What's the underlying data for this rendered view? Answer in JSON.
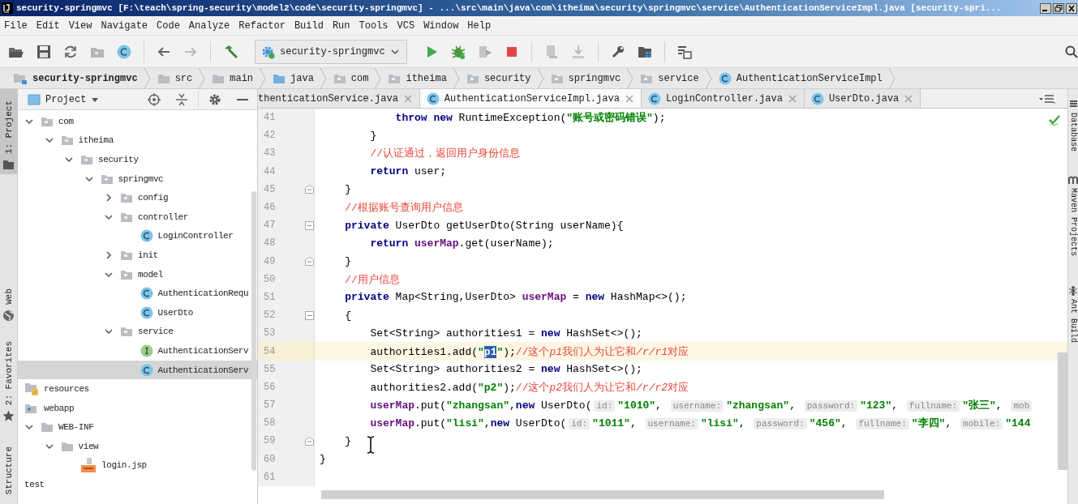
{
  "window": {
    "title": "security-springmvc [F:\\teach\\spring-security\\model2\\code\\security-springmvc] - ...\\src\\main\\java\\com\\itheima\\security\\springmvc\\service\\AuthenticationServiceImpl.java [security-spri..."
  },
  "menu": [
    "File",
    "Edit",
    "View",
    "Navigate",
    "Code",
    "Analyze",
    "Refactor",
    "Build",
    "Run",
    "Tools",
    "VCS",
    "Window",
    "Help"
  ],
  "toolbar": {
    "run_configuration": "security-springmvc"
  },
  "breadcrumbs": [
    {
      "label": "security-springmvc",
      "kind": "module"
    },
    {
      "label": "src",
      "kind": "folder"
    },
    {
      "label": "main",
      "kind": "folder"
    },
    {
      "label": "java",
      "kind": "source-folder"
    },
    {
      "label": "com",
      "kind": "package"
    },
    {
      "label": "itheima",
      "kind": "package"
    },
    {
      "label": "security",
      "kind": "package"
    },
    {
      "label": "springmvc",
      "kind": "package"
    },
    {
      "label": "service",
      "kind": "package"
    },
    {
      "label": "AuthenticationServiceImpl",
      "kind": "class"
    }
  ],
  "left_tool_tabs": [
    {
      "label": "1: Project",
      "kind": "project",
      "selected": true
    },
    {
      "label": "Web",
      "kind": "web",
      "selected": false
    },
    {
      "label": "2: Favorites",
      "kind": "favorites",
      "selected": false
    },
    {
      "label": "Structure",
      "selected": false
    }
  ],
  "project_panel": {
    "title": "Project",
    "tree": [
      {
        "label": "com",
        "kind": "package",
        "expanded": true,
        "selected": false,
        "children": [
          {
            "label": "itheima",
            "kind": "package",
            "expanded": true,
            "selected": false,
            "children": [
              {
                "label": "security",
                "kind": "package",
                "expanded": true,
                "selected": false,
                "children": [
                  {
                    "label": "springmvc",
                    "kind": "package",
                    "expanded": true,
                    "selected": false,
                    "children": [
                      {
                        "label": "config",
                        "kind": "package",
                        "expanded": false,
                        "selected": false
                      },
                      {
                        "label": "controller",
                        "kind": "package",
                        "expanded": true,
                        "selected": false,
                        "children": [
                          {
                            "label": "LoginController",
                            "kind": "class",
                            "selected": false
                          }
                        ]
                      },
                      {
                        "label": "init",
                        "kind": "package",
                        "expanded": false,
                        "selected": false
                      },
                      {
                        "label": "model",
                        "kind": "package",
                        "expanded": true,
                        "selected": false,
                        "children": [
                          {
                            "label": "AuthenticationRequ",
                            "kind": "class",
                            "selected": false
                          },
                          {
                            "label": "UserDto",
                            "kind": "class",
                            "selected": false
                          }
                        ]
                      },
                      {
                        "label": "service",
                        "kind": "package",
                        "expanded": true,
                        "selected": false,
                        "children": [
                          {
                            "label": "AuthenticationServ",
                            "kind": "interface",
                            "selected": false
                          },
                          {
                            "label": "AuthenticationServ",
                            "kind": "class",
                            "selected": true
                          }
                        ]
                      }
                    ]
                  }
                ]
              }
            ]
          }
        ]
      },
      {
        "label": "resources",
        "kind": "resources",
        "selected": false
      },
      {
        "label": "webapp",
        "kind": "web-root",
        "selected": false
      },
      {
        "label": "WEB-INF",
        "kind": "folder",
        "expanded": true,
        "selected": false,
        "children": [
          {
            "label": "view",
            "kind": "folder",
            "expanded": true,
            "selected": false,
            "children": [
              {
                "label": "login.jsp",
                "kind": "jsp",
                "selected": false
              }
            ]
          }
        ]
      },
      {
        "label": "test",
        "kind": "label",
        "selected": false
      }
    ]
  },
  "editor": {
    "tabs": [
      {
        "label": "thenticationService.java",
        "kind": "clipped",
        "selected": false
      },
      {
        "label": "AuthenticationServiceImpl.java",
        "kind": "class",
        "selected": true
      },
      {
        "label": "LoginController.java",
        "kind": "class",
        "selected": false
      },
      {
        "label": "UserDto.java",
        "kind": "class",
        "selected": false
      }
    ],
    "lines": [
      {
        "number": "41",
        "current": false,
        "fold_start": false,
        "fold_end": false,
        "tokens": [
          {
            "kind": "kw",
            "text": "            throw new"
          },
          {
            "kind": "plain",
            "text": " RuntimeException("
          },
          {
            "kind": "str",
            "text": "\"账号或密码错误\""
          },
          {
            "kind": "plain",
            "text": ");"
          }
        ]
      },
      {
        "number": "42",
        "current": false,
        "fold_start": false,
        "fold_end": false,
        "tokens": [
          {
            "kind": "plain",
            "text": "        }"
          }
        ]
      },
      {
        "number": "43",
        "current": false,
        "fold_start": false,
        "fold_end": false,
        "tokens": [
          {
            "kind": "comment",
            "text": "        //认证通过，返回用户身份信息"
          }
        ]
      },
      {
        "number": "44",
        "current": false,
        "fold_start": false,
        "fold_end": false,
        "tokens": [
          {
            "kind": "kw",
            "text": "        return"
          },
          {
            "kind": "plain",
            "text": " user;"
          }
        ]
      },
      {
        "number": "45",
        "current": false,
        "fold_start": false,
        "fold_end": true,
        "tokens": [
          {
            "kind": "plain",
            "text": "    }"
          }
        ]
      },
      {
        "number": "46",
        "current": false,
        "fold_start": false,
        "fold_end": false,
        "tokens": [
          {
            "kind": "comment",
            "text": "    //根据账号查询用户信息"
          }
        ]
      },
      {
        "number": "47",
        "current": false,
        "fold_start": true,
        "fold_end": false,
        "tokens": [
          {
            "kind": "kw",
            "text": "    private"
          },
          {
            "kind": "plain",
            "text": " UserDto getUserDto(String userName){"
          }
        ]
      },
      {
        "number": "48",
        "current": false,
        "fold_start": false,
        "fold_end": false,
        "tokens": [
          {
            "kind": "kw",
            "text": "        return "
          },
          {
            "kind": "field",
            "text": "userMap"
          },
          {
            "kind": "plain",
            "text": ".get(userName);"
          }
        ]
      },
      {
        "number": "49",
        "current": false,
        "fold_start": false,
        "fold_end": true,
        "tokens": [
          {
            "kind": "plain",
            "text": "    }"
          }
        ]
      },
      {
        "number": "50",
        "current": false,
        "fold_start": false,
        "fold_end": false,
        "tokens": [
          {
            "kind": "comment",
            "text": "    //用户信息"
          }
        ]
      },
      {
        "number": "51",
        "current": false,
        "fold_start": false,
        "fold_end": false,
        "tokens": [
          {
            "kind": "kw",
            "text": "    private"
          },
          {
            "kind": "plain",
            "text": " Map<String,UserDto> "
          },
          {
            "kind": "field",
            "text": "userMap"
          },
          {
            "kind": "plain",
            "text": " = "
          },
          {
            "kind": "kw",
            "text": "new"
          },
          {
            "kind": "plain",
            "text": " HashMap<>();"
          }
        ]
      },
      {
        "number": "52",
        "current": false,
        "fold_start": true,
        "fold_end": false,
        "tokens": [
          {
            "kind": "plain",
            "text": "    {"
          }
        ]
      },
      {
        "number": "53",
        "current": false,
        "fold_start": false,
        "fold_end": false,
        "tokens": [
          {
            "kind": "plain",
            "text": "        Set<String> authorities1 = "
          },
          {
            "kind": "kw",
            "text": "new"
          },
          {
            "kind": "plain",
            "text": " HashSet<>();"
          }
        ]
      },
      {
        "number": "54",
        "current": true,
        "fold_start": false,
        "fold_end": false,
        "tokens": [
          {
            "kind": "plain",
            "text": "        authorities1.add("
          },
          {
            "kind": "str",
            "text": "\""
          },
          {
            "kind": "str-selected",
            "text": "p1"
          },
          {
            "kind": "str",
            "text": "\""
          },
          {
            "kind": "plain",
            "text": ");"
          },
          {
            "kind": "comment",
            "text": "//这个"
          },
          {
            "kind": "comment-italic",
            "text": "p1"
          },
          {
            "kind": "comment",
            "text": "我们人为让它和"
          },
          {
            "kind": "comment-italic",
            "text": "/r/r1"
          },
          {
            "kind": "comment",
            "text": "对应"
          }
        ]
      },
      {
        "number": "55",
        "current": false,
        "fold_start": false,
        "fold_end": false,
        "tokens": [
          {
            "kind": "plain",
            "text": "        Set<String> authorities2 = "
          },
          {
            "kind": "kw",
            "text": "new"
          },
          {
            "kind": "plain",
            "text": " HashSet<>();"
          }
        ]
      },
      {
        "number": "56",
        "current": false,
        "fold_start": false,
        "fold_end": false,
        "tokens": [
          {
            "kind": "plain",
            "text": "        authorities2.add("
          },
          {
            "kind": "str",
            "text": "\"p2\""
          },
          {
            "kind": "plain",
            "text": ");"
          },
          {
            "kind": "comment",
            "text": "//这个"
          },
          {
            "kind": "comment-italic",
            "text": "p2"
          },
          {
            "kind": "comment",
            "text": "我们人为让它和"
          },
          {
            "kind": "comment-italic",
            "text": "/r/r2"
          },
          {
            "kind": "comment",
            "text": "对应"
          }
        ]
      },
      {
        "number": "57",
        "current": false,
        "fold_start": false,
        "fold_end": false,
        "tokens": [
          {
            "kind": "field",
            "text": "        userMap"
          },
          {
            "kind": "plain",
            "text": ".put("
          },
          {
            "kind": "str",
            "text": "\"zhangsan\""
          },
          {
            "kind": "plain",
            "text": ","
          },
          {
            "kind": "kw",
            "text": "new"
          },
          {
            "kind": "plain",
            "text": " UserDto("
          },
          {
            "kind": "hint",
            "text": "id:"
          },
          {
            "kind": "str",
            "text": "\"1010\""
          },
          {
            "kind": "plain",
            "text": ", "
          },
          {
            "kind": "hint",
            "text": "username:"
          },
          {
            "kind": "str",
            "text": "\"zhangsan\""
          },
          {
            "kind": "plain",
            "text": ", "
          },
          {
            "kind": "hint",
            "text": "password:"
          },
          {
            "kind": "str",
            "text": "\"123\""
          },
          {
            "kind": "plain",
            "text": ", "
          },
          {
            "kind": "hint",
            "text": "fullname:"
          },
          {
            "kind": "str",
            "text": "\"张三\""
          },
          {
            "kind": "plain",
            "text": ", "
          },
          {
            "kind": "hint",
            "text": "mob"
          }
        ]
      },
      {
        "number": "58",
        "current": false,
        "fold_start": false,
        "fold_end": false,
        "tokens": [
          {
            "kind": "field",
            "text": "        userMap"
          },
          {
            "kind": "plain",
            "text": ".put("
          },
          {
            "kind": "str",
            "text": "\"lisi\""
          },
          {
            "kind": "plain",
            "text": ","
          },
          {
            "kind": "kw",
            "text": "new"
          },
          {
            "kind": "plain",
            "text": " UserDto("
          },
          {
            "kind": "hint",
            "text": "id:"
          },
          {
            "kind": "str",
            "text": "\"1011\""
          },
          {
            "kind": "plain",
            "text": ", "
          },
          {
            "kind": "hint",
            "text": "username:"
          },
          {
            "kind": "str",
            "text": "\"lisi\""
          },
          {
            "kind": "plain",
            "text": ", "
          },
          {
            "kind": "hint",
            "text": "password:"
          },
          {
            "kind": "str",
            "text": "\"456\""
          },
          {
            "kind": "plain",
            "text": ", "
          },
          {
            "kind": "hint",
            "text": "fullname:"
          },
          {
            "kind": "str",
            "text": "\"李四\""
          },
          {
            "kind": "plain",
            "text": ", "
          },
          {
            "kind": "hint",
            "text": "mobile:"
          },
          {
            "kind": "str",
            "text": "\"144"
          }
        ]
      },
      {
        "number": "59",
        "current": false,
        "fold_start": false,
        "fold_end": true,
        "tokens": [
          {
            "kind": "plain",
            "text": "    }"
          }
        ]
      },
      {
        "number": "60",
        "current": false,
        "fold_start": false,
        "fold_end": false,
        "tokens": [
          {
            "kind": "plain",
            "text": "}"
          }
        ]
      },
      {
        "number": "61",
        "current": false,
        "fold_start": false,
        "fold_end": false
      }
    ]
  },
  "right_tool_tabs": [
    {
      "label": "Database",
      "kind": "database"
    },
    {
      "label": "Maven Projects",
      "kind": "maven"
    },
    {
      "label": "Ant Build",
      "kind": "ant"
    }
  ]
}
